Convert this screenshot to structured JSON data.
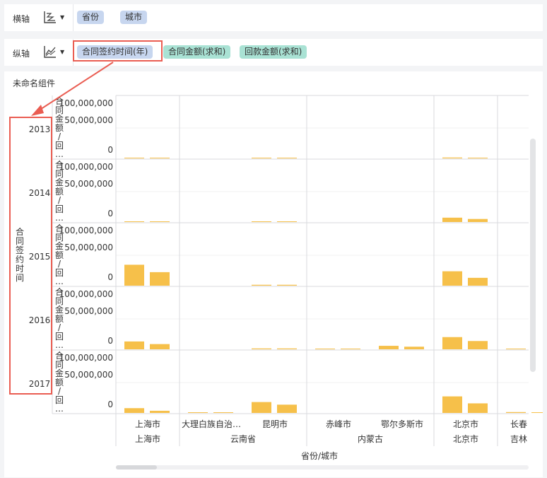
{
  "shelf_x": {
    "label": "横轴",
    "pills": [
      "省份",
      "城市"
    ],
    "icon": "scatter-chart-icon"
  },
  "shelf_y": {
    "label": "纵轴",
    "pills": [
      "合同签约时间(年)",
      "合同金额(求和)",
      "回款金额(求和)"
    ],
    "icon": "line-chart-icon"
  },
  "component": {
    "title": "未命名组件"
  },
  "colors": {
    "bar": "#f6c04a",
    "bar_light": "#fcd98a",
    "highlight": "#ea5d52",
    "pill_blue": "#c7d6ef",
    "pill_green": "#a9e2d4"
  },
  "row_dimension_label": "合同签约时间",
  "measure_row_label": "合同金额/回…",
  "x_axis_title": "省份/城市",
  "chart_data": {
    "type": "bar",
    "title": "",
    "rows": [
      "2013",
      "2014",
      "2015",
      "2016",
      "2017"
    ],
    "y_tick_labels": [
      "100,000,000",
      "50,000,000",
      "0"
    ],
    "ylim": [
      0,
      120000000
    ],
    "categories": [
      "上海市",
      "大理白族自治…",
      "昆明市",
      "赤峰市",
      "鄂尔多斯市",
      "北京市",
      "长春"
    ],
    "provinces": [
      {
        "name": "上海市",
        "cities": [
          "上海市"
        ]
      },
      {
        "name": "云南省",
        "cities": [
          "大理白族自治…",
          "昆明市"
        ]
      },
      {
        "name": "内蒙古",
        "cities": [
          "赤峰市",
          "鄂尔多斯市"
        ]
      },
      {
        "name": "北京市",
        "cities": [
          "北京市"
        ]
      },
      {
        "name": "吉林",
        "cities": [
          "长春"
        ]
      }
    ],
    "series": [
      {
        "measure": "合同金额(求和)",
        "values_by_row": [
          [
            1500000,
            0,
            500000,
            0,
            0,
            2000000,
            0
          ],
          [
            1000000,
            0,
            1000000,
            0,
            0,
            10000000,
            0
          ],
          [
            48000000,
            0,
            2000000,
            0,
            0,
            33000000,
            0
          ],
          [
            18000000,
            0,
            2000000,
            1000000,
            8000000,
            28000000,
            1000000
          ],
          [
            11000000,
            1000000,
            25000000,
            0,
            0,
            38000000,
            2000000
          ]
        ]
      },
      {
        "measure": "回款金额(求和)",
        "values_by_row": [
          [
            1000000,
            0,
            500000,
            0,
            0,
            1000000,
            0
          ],
          [
            1000000,
            0,
            1000000,
            0,
            0,
            7000000,
            0
          ],
          [
            31000000,
            0,
            2000000,
            0,
            0,
            18000000,
            0
          ],
          [
            12000000,
            0,
            2000000,
            1000000,
            6000000,
            19000000,
            0
          ],
          [
            5000000,
            1000000,
            19000000,
            0,
            0,
            22000000,
            1000000
          ]
        ]
      }
    ],
    "grid": true,
    "legend": "none"
  }
}
